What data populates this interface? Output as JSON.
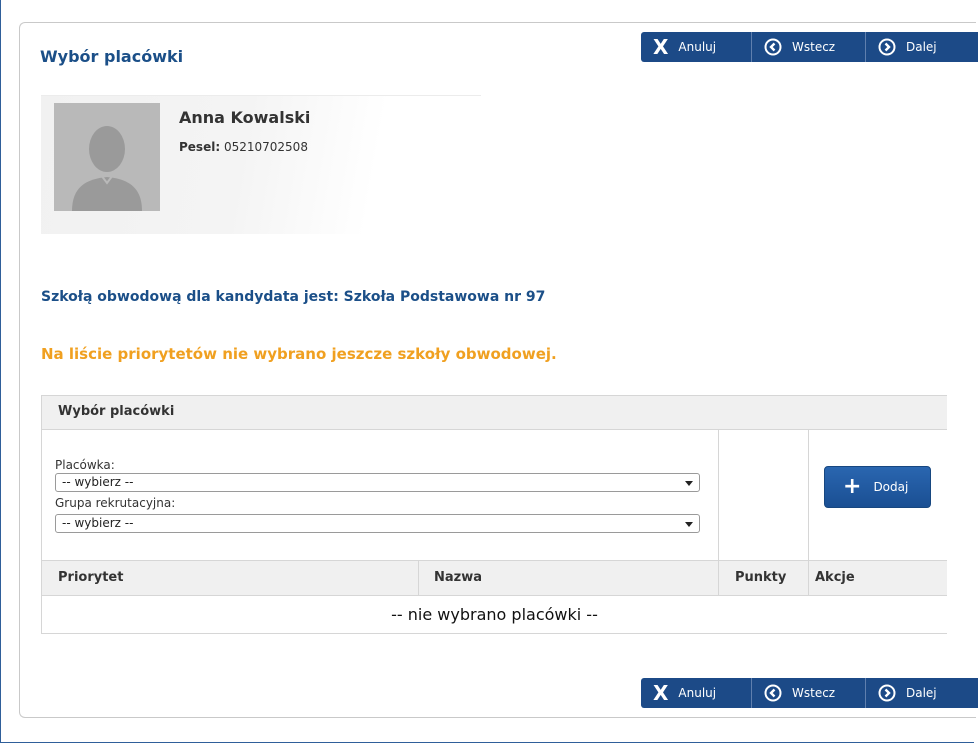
{
  "page": {
    "title": "Wybór placówki"
  },
  "nav": {
    "cancel_label": "Anuluj",
    "back_label": "Wstecz",
    "next_label": "Dalej",
    "icon_color": "#ffffff",
    "bar_color": "#1c4a87"
  },
  "candidate": {
    "name": "Anna Kowalski",
    "pesel_label": "Pesel:",
    "pesel_value": "05210702508"
  },
  "messages": {
    "district_school": "Szkołą obwodową dla kandydata jest: Szkoła Podstawowa nr 97",
    "warning": "Na liście priorytetów nie wybrano jeszcze szkoły obwodowej.",
    "warning_color": "#f0a020"
  },
  "selection": {
    "header": "Wybór placówki",
    "facility_label": "Placówka:",
    "facility_value": "-- wybierz --",
    "group_label": "Grupa rekrutacyjna:",
    "group_value": "-- wybierz --",
    "add_label": "Dodaj"
  },
  "table": {
    "columns": [
      "Priorytet",
      "Nazwa",
      "Punkty",
      "Akcje"
    ],
    "empty_text": "-- nie wybrano placówki --"
  }
}
